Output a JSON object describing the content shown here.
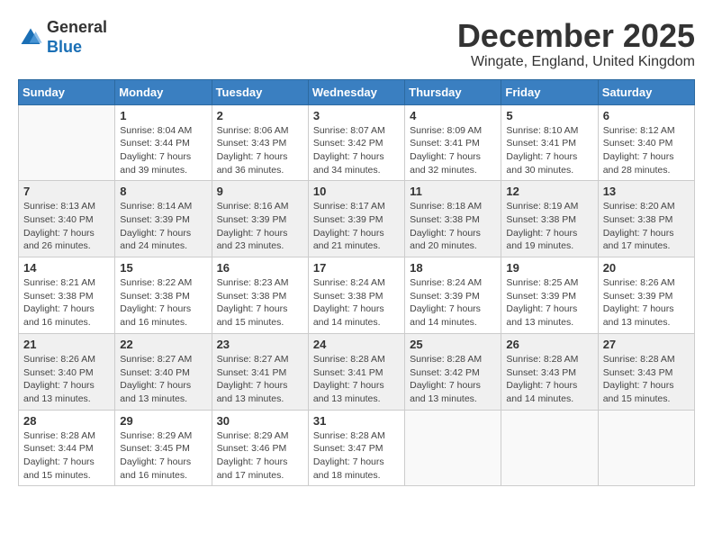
{
  "header": {
    "logo_general": "General",
    "logo_blue": "Blue",
    "month_title": "December 2025",
    "location": "Wingate, England, United Kingdom"
  },
  "days_of_week": [
    "Sunday",
    "Monday",
    "Tuesday",
    "Wednesday",
    "Thursday",
    "Friday",
    "Saturday"
  ],
  "weeks": [
    [
      {
        "day": "",
        "info": ""
      },
      {
        "day": "1",
        "info": "Sunrise: 8:04 AM\nSunset: 3:44 PM\nDaylight: 7 hours\nand 39 minutes."
      },
      {
        "day": "2",
        "info": "Sunrise: 8:06 AM\nSunset: 3:43 PM\nDaylight: 7 hours\nand 36 minutes."
      },
      {
        "day": "3",
        "info": "Sunrise: 8:07 AM\nSunset: 3:42 PM\nDaylight: 7 hours\nand 34 minutes."
      },
      {
        "day": "4",
        "info": "Sunrise: 8:09 AM\nSunset: 3:41 PM\nDaylight: 7 hours\nand 32 minutes."
      },
      {
        "day": "5",
        "info": "Sunrise: 8:10 AM\nSunset: 3:41 PM\nDaylight: 7 hours\nand 30 minutes."
      },
      {
        "day": "6",
        "info": "Sunrise: 8:12 AM\nSunset: 3:40 PM\nDaylight: 7 hours\nand 28 minutes."
      }
    ],
    [
      {
        "day": "7",
        "info": "Sunrise: 8:13 AM\nSunset: 3:40 PM\nDaylight: 7 hours\nand 26 minutes."
      },
      {
        "day": "8",
        "info": "Sunrise: 8:14 AM\nSunset: 3:39 PM\nDaylight: 7 hours\nand 24 minutes."
      },
      {
        "day": "9",
        "info": "Sunrise: 8:16 AM\nSunset: 3:39 PM\nDaylight: 7 hours\nand 23 minutes."
      },
      {
        "day": "10",
        "info": "Sunrise: 8:17 AM\nSunset: 3:39 PM\nDaylight: 7 hours\nand 21 minutes."
      },
      {
        "day": "11",
        "info": "Sunrise: 8:18 AM\nSunset: 3:38 PM\nDaylight: 7 hours\nand 20 minutes."
      },
      {
        "day": "12",
        "info": "Sunrise: 8:19 AM\nSunset: 3:38 PM\nDaylight: 7 hours\nand 19 minutes."
      },
      {
        "day": "13",
        "info": "Sunrise: 8:20 AM\nSunset: 3:38 PM\nDaylight: 7 hours\nand 17 minutes."
      }
    ],
    [
      {
        "day": "14",
        "info": "Sunrise: 8:21 AM\nSunset: 3:38 PM\nDaylight: 7 hours\nand 16 minutes."
      },
      {
        "day": "15",
        "info": "Sunrise: 8:22 AM\nSunset: 3:38 PM\nDaylight: 7 hours\nand 16 minutes."
      },
      {
        "day": "16",
        "info": "Sunrise: 8:23 AM\nSunset: 3:38 PM\nDaylight: 7 hours\nand 15 minutes."
      },
      {
        "day": "17",
        "info": "Sunrise: 8:24 AM\nSunset: 3:38 PM\nDaylight: 7 hours\nand 14 minutes."
      },
      {
        "day": "18",
        "info": "Sunrise: 8:24 AM\nSunset: 3:39 PM\nDaylight: 7 hours\nand 14 minutes."
      },
      {
        "day": "19",
        "info": "Sunrise: 8:25 AM\nSunset: 3:39 PM\nDaylight: 7 hours\nand 13 minutes."
      },
      {
        "day": "20",
        "info": "Sunrise: 8:26 AM\nSunset: 3:39 PM\nDaylight: 7 hours\nand 13 minutes."
      }
    ],
    [
      {
        "day": "21",
        "info": "Sunrise: 8:26 AM\nSunset: 3:40 PM\nDaylight: 7 hours\nand 13 minutes."
      },
      {
        "day": "22",
        "info": "Sunrise: 8:27 AM\nSunset: 3:40 PM\nDaylight: 7 hours\nand 13 minutes."
      },
      {
        "day": "23",
        "info": "Sunrise: 8:27 AM\nSunset: 3:41 PM\nDaylight: 7 hours\nand 13 minutes."
      },
      {
        "day": "24",
        "info": "Sunrise: 8:28 AM\nSunset: 3:41 PM\nDaylight: 7 hours\nand 13 minutes."
      },
      {
        "day": "25",
        "info": "Sunrise: 8:28 AM\nSunset: 3:42 PM\nDaylight: 7 hours\nand 13 minutes."
      },
      {
        "day": "26",
        "info": "Sunrise: 8:28 AM\nSunset: 3:43 PM\nDaylight: 7 hours\nand 14 minutes."
      },
      {
        "day": "27",
        "info": "Sunrise: 8:28 AM\nSunset: 3:43 PM\nDaylight: 7 hours\nand 15 minutes."
      }
    ],
    [
      {
        "day": "28",
        "info": "Sunrise: 8:28 AM\nSunset: 3:44 PM\nDaylight: 7 hours\nand 15 minutes."
      },
      {
        "day": "29",
        "info": "Sunrise: 8:29 AM\nSunset: 3:45 PM\nDaylight: 7 hours\nand 16 minutes."
      },
      {
        "day": "30",
        "info": "Sunrise: 8:29 AM\nSunset: 3:46 PM\nDaylight: 7 hours\nand 17 minutes."
      },
      {
        "day": "31",
        "info": "Sunrise: 8:28 AM\nSunset: 3:47 PM\nDaylight: 7 hours\nand 18 minutes."
      },
      {
        "day": "",
        "info": ""
      },
      {
        "day": "",
        "info": ""
      },
      {
        "day": "",
        "info": ""
      }
    ]
  ]
}
